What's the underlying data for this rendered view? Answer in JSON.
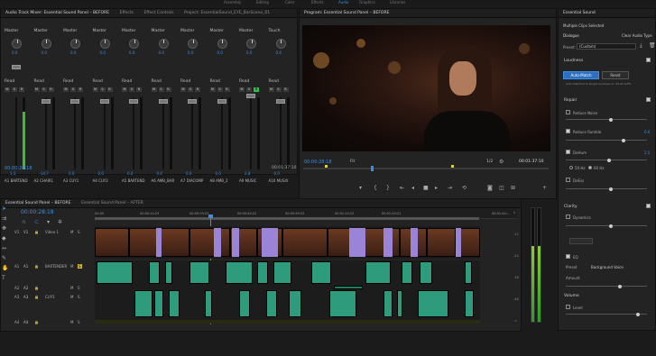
{
  "workspace": {
    "tabs": [
      "Assembly",
      "Editing",
      "Color",
      "Effects",
      "Audio",
      "Graphics",
      "Libraries"
    ],
    "active": "Audio"
  },
  "mixer_panel": {
    "tabs": [
      "Audio Track Mixer: Essential Sound Panel – BEFORE",
      "Effects",
      "Effect Controls",
      "Project: EssentialSound_EYE_BarScene_01"
    ],
    "read_label": "Read",
    "channels": [
      {
        "label": "Master",
        "kval": "0.0",
        "value": "1.5",
        "name": "BARTEND",
        "id": "A1"
      },
      {
        "label": "Master",
        "kval": "0.0",
        "value": "-14.7",
        "name": "CHAIR1",
        "id": "A2"
      },
      {
        "label": "Master",
        "kval": "0.0",
        "value": "0.0",
        "name": "CUY1",
        "id": "A3"
      },
      {
        "label": "Master",
        "kval": "0.0",
        "value": "0.0",
        "name": "CUY2",
        "id": "A4"
      },
      {
        "label": "Master",
        "kval": "0.0",
        "value": "0.0",
        "name": "BARTEND",
        "id": "A5"
      },
      {
        "label": "Master",
        "kval": "0.0",
        "value": "0.0",
        "name": "AMB_BAR",
        "id": "A6"
      },
      {
        "label": "Master",
        "kval": "0.0",
        "value": "0.0",
        "name": "DIACOMP",
        "id": "A7"
      },
      {
        "label": "Master",
        "kval": "0.0",
        "value": "0.0",
        "name": "AMB_2",
        "id": "A8"
      },
      {
        "label": "Master",
        "kval": "0.0",
        "value": "2.8",
        "name": "MUSIC",
        "id": "A9"
      },
      {
        "label": "Touch",
        "kval": "0.0",
        "value": "0.0",
        "name": "MUSIX",
        "id": "A10"
      }
    ],
    "bottom_left_tc": "00:00:28:18",
    "bottom_right_tc": "00:01:37:10"
  },
  "program_monitor": {
    "tab": "Program: Essential Sound Panel – BEFORE",
    "current_tc": "00:00:28:18",
    "fit": "Fit",
    "fraction": "1/2",
    "duration_tc": "00:01:37:10"
  },
  "essential_sound": {
    "tab": "Essential Sound",
    "selection": "Multiple Clips Selected",
    "dialogue": "Dialogue",
    "clear_btn": "Clear Audio Type",
    "preset_label": "Preset:",
    "preset_value": "(Custom)",
    "loudness_header": "Loudness",
    "auto_match_btn": "Auto-Match",
    "reset_btn": "Reset",
    "loudness_note": "Auto-Matched to target loudness of -23.00 LUFS",
    "repair_header": "Repair",
    "reduce_noise": "Reduce Noise",
    "reduce_rumble": "Reduce Rumble",
    "rumble_value": "6.6",
    "dehum": "DeHum",
    "dehum_value": "2.5",
    "hz50": "50 Hz",
    "hz60": "60 Hz",
    "deess": "DeEss",
    "clarity_header": "Clarity",
    "dynamics": "Dynamics",
    "eq": "EQ",
    "eq_preset_label": "Preset",
    "eq_preset_value": "Background Voice",
    "amount_label": "Amount",
    "volume_header": "Volume",
    "level": "Level"
  },
  "timeline": {
    "tabs": [
      "Essential Sound Panel – BEFORE",
      "Essential Sound Panel – AFTER"
    ],
    "current_tc": "00:00:28:18",
    "ruler": [
      "00:00",
      "00:00:14:23",
      "00:00:29:23",
      "00:00:44:22",
      "00:00:59:22",
      "00:01:14:22",
      "00:01:29:21",
      "00:01:44:..."
    ],
    "tracks": [
      {
        "id": "V1",
        "name": "Video 1"
      },
      {
        "id": "A1",
        "name": "BARTENDER"
      },
      {
        "id": "A2",
        "name": ""
      },
      {
        "id": "A3",
        "name": "CUY1"
      },
      {
        "id": "A4",
        "name": ""
      }
    ],
    "meter_labels": [
      "0",
      "-12",
      "-24",
      "-36",
      "-48",
      "-∞"
    ]
  }
}
